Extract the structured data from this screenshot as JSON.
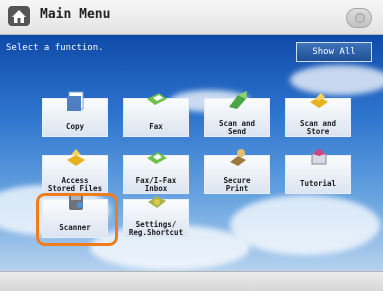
{
  "header": {
    "title": "Main Menu"
  },
  "instruction": "Select a function.",
  "show_all_label": "Show All",
  "functions": [
    {
      "line1": "Copy",
      "line2": "",
      "icon": "copy-icon"
    },
    {
      "line1": "Fax",
      "line2": "",
      "icon": "fax-icon"
    },
    {
      "line1": "Scan and",
      "line2": "Send",
      "icon": "scan-and-send-icon"
    },
    {
      "line1": "Scan and",
      "line2": "Store",
      "icon": "scan-and-store-icon"
    },
    {
      "line1": "Access",
      "line2": "Stored Files",
      "icon": "access-stored-files-icon"
    },
    {
      "line1": "Fax/I-Fax",
      "line2": "Inbox",
      "icon": "fax-inbox-icon"
    },
    {
      "line1": "Secure",
      "line2": "Print",
      "icon": "secure-print-icon"
    },
    {
      "line1": "Tutorial",
      "line2": "",
      "icon": "tutorial-icon"
    },
    {
      "line1": "Scanner",
      "line2": "",
      "icon": "scanner-icon"
    },
    {
      "line1": "Settings/",
      "line2": "Reg.Shortcut",
      "icon": "settings-icon"
    }
  ],
  "colors": {
    "accent_highlight": "#ef7d1c",
    "background_blue": "#2f76cf"
  }
}
